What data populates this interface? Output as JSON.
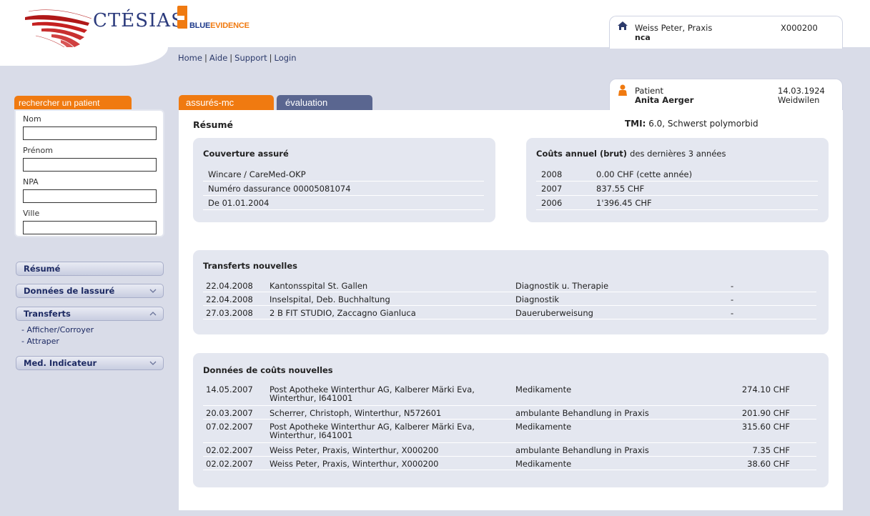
{
  "brand": {
    "ctesias": "CTÉSIAS",
    "blue": "BLUE",
    "evidence": "EVIDENCE"
  },
  "user": {
    "name": "Weiss Peter, Praxis",
    "id": "X000200",
    "sub": "nca"
  },
  "topnav": [
    "Home",
    "Aide",
    "Support",
    "Login"
  ],
  "search": {
    "tab_label": "rechercher un patient",
    "fields": [
      {
        "label": "Nom",
        "value": ""
      },
      {
        "label": "Prénom",
        "value": ""
      },
      {
        "label": "NPA",
        "value": ""
      },
      {
        "label": "Ville",
        "value": ""
      }
    ]
  },
  "sidebar": {
    "items": [
      {
        "label": "Résumé"
      },
      {
        "label": "Données de lassuré"
      },
      {
        "label": "Transferts"
      },
      {
        "label": "Med. Indicateur"
      }
    ],
    "transferts_sub": [
      "- Afficher/Corroyer",
      "- Attraper"
    ]
  },
  "tabs": [
    "assurés-mc",
    "évaluation"
  ],
  "patient": {
    "label": "Patient",
    "name": "Anita Aerger",
    "dob": "14.03.1924",
    "city": "Weidwilen"
  },
  "main": {
    "title": "Résumé",
    "tmi_label": "TMI:",
    "tmi_value": "6.0, Schwerst polymorbid"
  },
  "coverage": {
    "title": "Couverture assuré",
    "rows": [
      "Wincare / CareMed-OKP",
      "Numéro dassurance 00005081074",
      "De 01.01.2004"
    ]
  },
  "annual_costs": {
    "title_bold": "Coûts annuel (brut)",
    "title_rest": "des dernières 3 années",
    "rows": [
      {
        "year": "2008",
        "amount": "0.00 CHF (cette année)"
      },
      {
        "year": "2007",
        "amount": "837.55 CHF"
      },
      {
        "year": "2006",
        "amount": "1'396.45 CHF"
      }
    ]
  },
  "transfers": {
    "title": "Transferts nouvelles",
    "rows": [
      {
        "date": "22.04.2008",
        "name": "Kantonsspital St. Gallen",
        "type": "Diagnostik u. Therapie",
        "extra": "-"
      },
      {
        "date": "22.04.2008",
        "name": "Inselspital, Deb. Buchhaltung",
        "type": "Diagnostik",
        "extra": "-"
      },
      {
        "date": "27.03.2008",
        "name": "2 B FIT STUDIO, Zaccagno Gianluca",
        "type": "Daueruberweisung",
        "extra": "-"
      }
    ]
  },
  "cost_data": {
    "title": "Données de coûts nouvelles",
    "rows": [
      {
        "date": "14.05.2007",
        "line1": "Post Apotheke Winterthur AG, Kalberer Märki Eva,",
        "line2": "Winterthur, I641001",
        "type": "Medikamente",
        "amount": "274.10 CHF"
      },
      {
        "date": "20.03.2007",
        "line1": "Scherrer, Christoph, Winterthur, N572601",
        "line2": "",
        "type": "ambulante Behandlung in Praxis",
        "amount": "201.90 CHF"
      },
      {
        "date": "07.02.2007",
        "line1": "Post Apotheke Winterthur AG, Kalberer Märki Eva,",
        "line2": "Winterthur, I641001",
        "type": "Medikamente",
        "amount": "315.60 CHF"
      },
      {
        "date": "02.02.2007",
        "line1": "Weiss Peter, Praxis, Winterthur, X000200",
        "line2": "",
        "type": "ambulante Behandlung in Praxis",
        "amount": "7.35 CHF"
      },
      {
        "date": "02.02.2007",
        "line1": "Weiss Peter, Praxis, Winterthur, X000200",
        "line2": "",
        "type": "Medikamente",
        "amount": "38.60 CHF"
      }
    ]
  }
}
